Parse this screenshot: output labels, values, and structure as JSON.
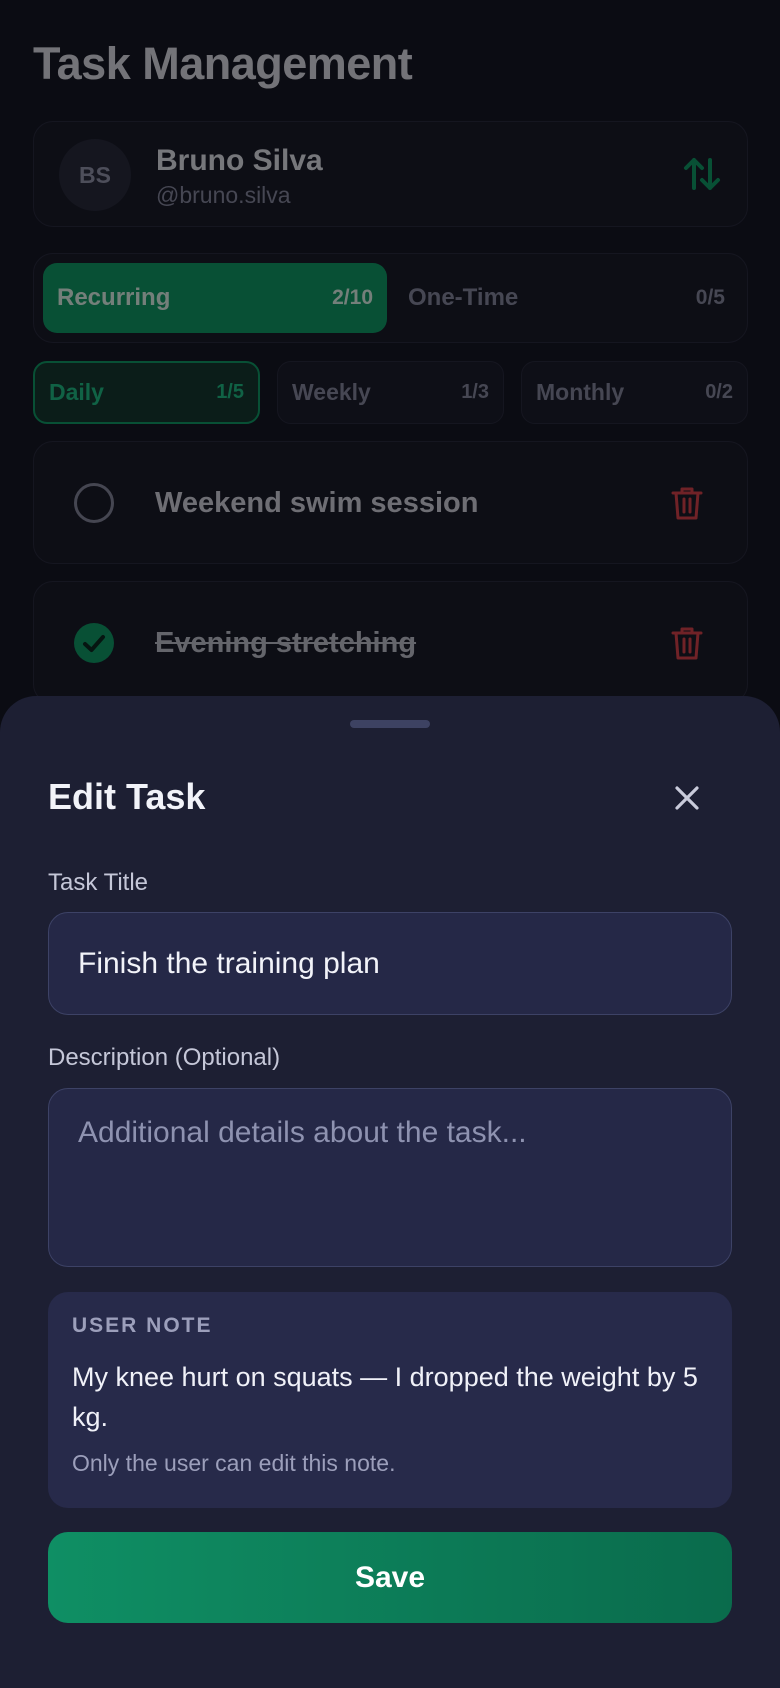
{
  "app": {
    "title": "Task Management"
  },
  "profile": {
    "initials": "BS",
    "name": "Bruno Silva",
    "handle": "@bruno.silva"
  },
  "task_type_tabs": [
    {
      "label": "Recurring",
      "count": "2/10",
      "active": true
    },
    {
      "label": "One-Time",
      "count": "0/5",
      "active": false
    }
  ],
  "frequency_tabs": [
    {
      "label": "Daily",
      "count": "1/5",
      "active": true
    },
    {
      "label": "Weekly",
      "count": "1/3",
      "active": false
    },
    {
      "label": "Monthly",
      "count": "0/2",
      "active": false
    }
  ],
  "tasks": [
    {
      "title": "Weekend swim session",
      "completed": false
    },
    {
      "title": "Evening stretching",
      "completed": true
    }
  ],
  "edit_sheet": {
    "title": "Edit Task",
    "task_title_label": "Task Title",
    "task_title_value": "Finish the training plan",
    "description_label": "Description (Optional)",
    "description_placeholder": "Additional details about the task...",
    "note": {
      "heading": "USER NOTE",
      "text": "My knee hurt on squats — I dropped the weight by 5 kg.",
      "footnote": "Only the user can edit this note."
    },
    "save_label": "Save"
  },
  "colors": {
    "accent": "#10a06b",
    "danger": "#e0454f",
    "sheet_background": "#1d1f33"
  }
}
